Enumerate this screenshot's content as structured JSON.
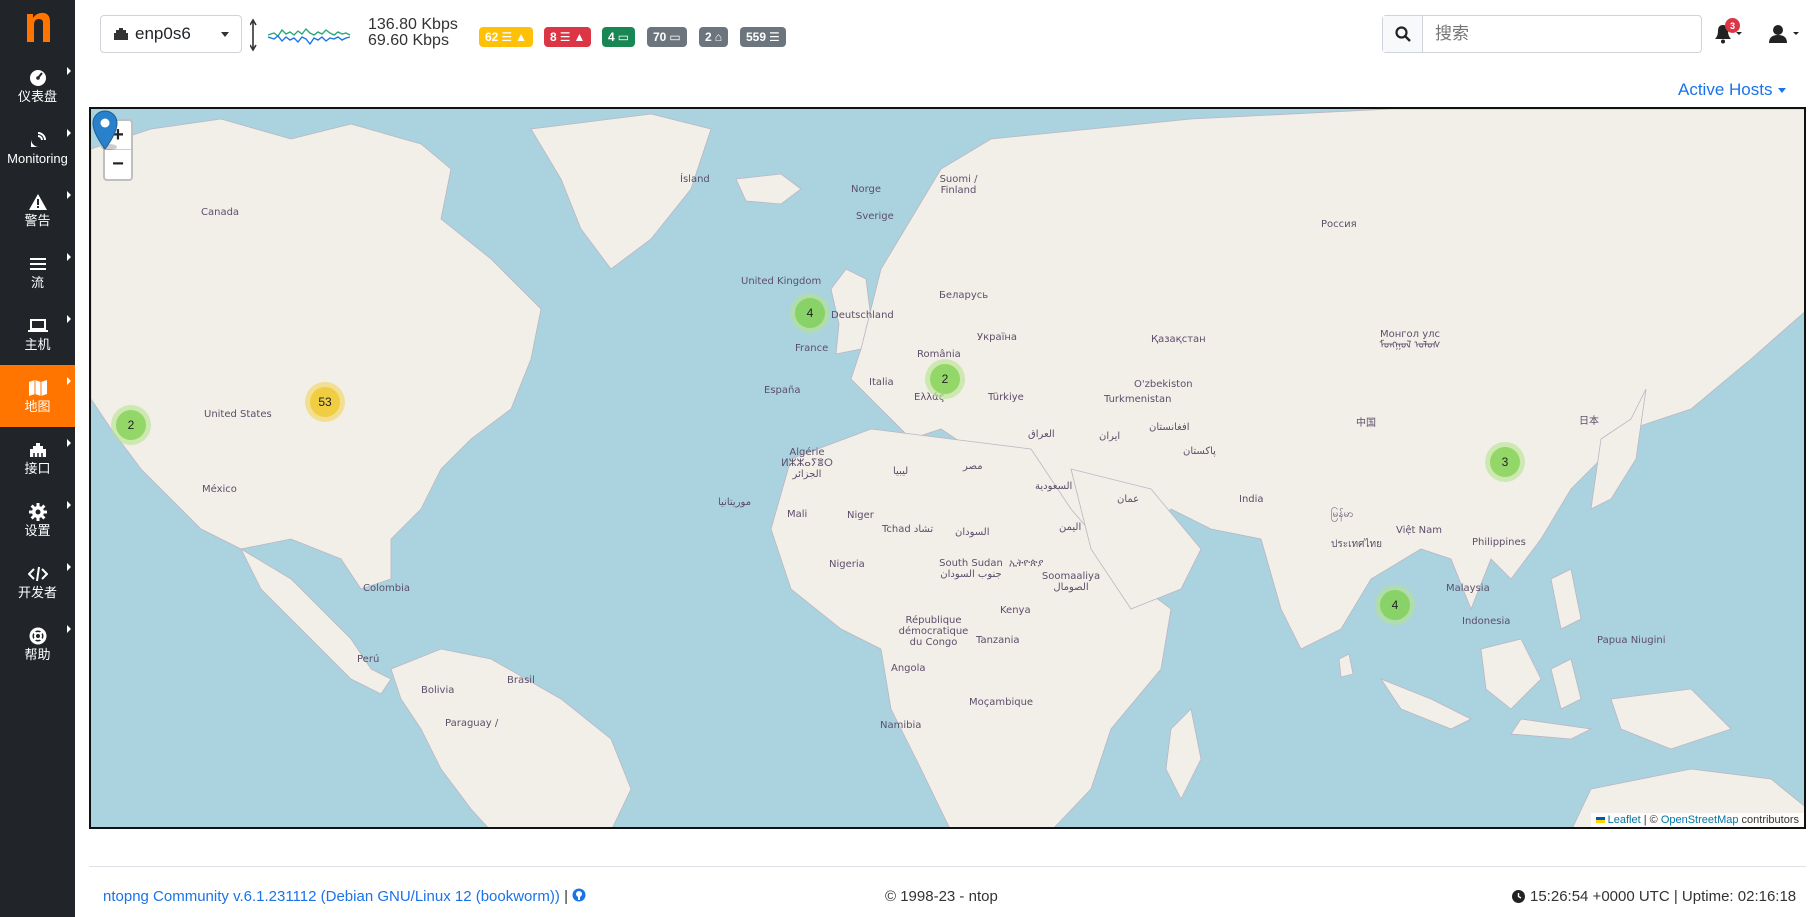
{
  "app": {
    "logo_letter": "n",
    "brand_color": "#ff7500"
  },
  "sidebar": {
    "items": [
      {
        "label": "仪表盘",
        "icon": "gauge-icon"
      },
      {
        "label": "Monitoring",
        "icon": "satellite-dish-icon"
      },
      {
        "label": "警告",
        "icon": "warning-icon"
      },
      {
        "label": "流",
        "icon": "list-icon"
      },
      {
        "label": "主机",
        "icon": "laptop-icon"
      },
      {
        "label": "地图",
        "icon": "map-icon",
        "active": true
      },
      {
        "label": "接口",
        "icon": "ethernet-icon"
      },
      {
        "label": "设置",
        "icon": "gear-icon"
      },
      {
        "label": "开发者",
        "icon": "code-icon"
      },
      {
        "label": "帮助",
        "icon": "lifebuoy-icon"
      }
    ]
  },
  "topbar": {
    "interface": "enp0s6",
    "rate_up": "136.80 Kbps",
    "rate_down": "69.60 Kbps",
    "badges": [
      {
        "value": "62",
        "color": "#ffc107",
        "icon": "warning-icon"
      },
      {
        "value": "8",
        "color": "#dc3545",
        "icon": "warning-icon"
      },
      {
        "value": "4",
        "color": "#198754",
        "icon": "laptop-icon"
      },
      {
        "value": "70",
        "color": "#6c757d",
        "icon": "laptop-icon"
      },
      {
        "value": "2",
        "color": "#6c757d",
        "icon": "device-icon"
      },
      {
        "value": "559",
        "color": "#6c757d",
        "icon": "list-icon"
      }
    ],
    "search_placeholder": "搜索",
    "notification_count": "3"
  },
  "content": {
    "active_hosts_label": "Active Hosts",
    "map": {
      "zoom_in": "+",
      "zoom_out": "−",
      "clusters": [
        {
          "count": "2",
          "kind": "small"
        },
        {
          "count": "53",
          "kind": "medium"
        },
        {
          "count": "4",
          "kind": "small"
        },
        {
          "count": "2",
          "kind": "small"
        },
        {
          "count": "3",
          "kind": "small"
        },
        {
          "count": "4",
          "kind": "small"
        }
      ],
      "place_labels": [
        "Ísland",
        "Canada",
        "Norge",
        "Suomi / Finland",
        "Sverige",
        "Россия",
        "United Kingdom",
        "Deutschland",
        "Беларусь",
        "France",
        "Україна",
        "România",
        "Қазақстан",
        "Монгол улс ᠮᠣᠩᠭᠣᠯ ᠤᠯᠤᠰ",
        "United States",
        "España",
        "Italia",
        "Ελλάς",
        "Türkiye",
        "O'zbekiston",
        "Turkmenistan",
        "中国",
        "日本",
        "Algérie ⵍⵣⵣⴰⵢⴻⵔ الجزائر",
        "ليبيا",
        "مصر",
        "العراق",
        "ایران",
        "افغانستان",
        "پاکستان",
        "México",
        "India",
        "موريتانيا",
        "Mali",
        "Niger",
        "Tchad تشاد",
        "السودان",
        "السعودية",
        "عمان",
        "اليمن",
        "မြန်မာ",
        "ประเทศไทย",
        "Việt Nam",
        "Philippines",
        "Nigeria",
        "South Sudan جنوب السودان",
        "ኢትዮጵያ",
        "Soomaaliya الصومال",
        "Colombia",
        "Kenya",
        "Malaysia",
        "Indonesia",
        "République démocratique du Congo",
        "Tanzania",
        "Papua Niugini",
        "Perú",
        "Brasil",
        "Bolivia",
        "Angola",
        "Moçambique",
        "Paraguay /",
        "Namibia"
      ],
      "attribution_leaflet": "Leaflet",
      "attribution_sep": " | © ",
      "attribution_osm": "OpenStreetMap",
      "attribution_tail": " contributors"
    }
  },
  "footer": {
    "version": "ntopng Community v.6.1.231112 (Debian GNU/Linux 12 (bookworm))",
    "copyright": "© 1998-23 - ntop",
    "status": "15:26:54 +0000 UTC | Uptime: 02:16:18"
  }
}
